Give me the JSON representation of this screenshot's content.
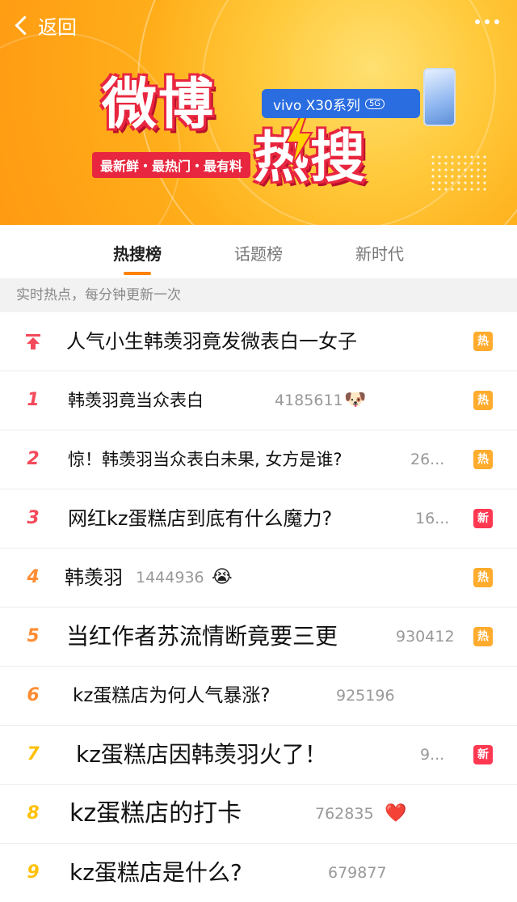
{
  "header": {
    "back_label": "返回",
    "logo_line1": "微博",
    "logo_line2": "热搜",
    "tagline": "最新鲜・最热门・最有料",
    "sponsor": "vivo X30系列",
    "sponsor_badge": "5G"
  },
  "tabs": [
    {
      "label": "热搜榜",
      "active": true
    },
    {
      "label": "话题榜",
      "active": false
    },
    {
      "label": "新时代",
      "active": false
    }
  ],
  "notice": "实时热点，每分钟更新一次",
  "colors": {
    "accent": "#ff8200",
    "hot_badge": "#ffab2d",
    "new_badge": "#ff3852",
    "top_rank": "#f4495a",
    "rank_mid": "#fe8c32",
    "rank_low": "#ffc107"
  },
  "list": [
    {
      "rank": "",
      "pinned": true,
      "title": "人气小生韩羡羽竟发微表白一女子",
      "count": "",
      "emoji": "",
      "badge": "热",
      "badge_type": "hot"
    },
    {
      "rank": "1",
      "title": "韩羡羽竟当众表白",
      "count": "4185611",
      "emoji": "🐶",
      "badge": "热",
      "badge_type": "hot"
    },
    {
      "rank": "2",
      "title": "惊！韩羡羽当众表白未果, 女方是谁?",
      "count": "26...",
      "emoji": "",
      "badge": "热",
      "badge_type": "hot"
    },
    {
      "rank": "3",
      "title": "网红kz蛋糕店到底有什么魔力?",
      "count": "16...",
      "emoji": "",
      "badge": "新",
      "badge_type": "new"
    },
    {
      "rank": "4",
      "title": "韩羡羽",
      "count": "1444936",
      "emoji": "😭",
      "badge": "热",
      "badge_type": "hot"
    },
    {
      "rank": "5",
      "title": "当红作者苏流情断竟要三更",
      "count": "930412",
      "emoji": "",
      "badge": "热",
      "badge_type": "hot"
    },
    {
      "rank": "6",
      "title": "kz蛋糕店为何人气暴涨?",
      "count": "925196",
      "emoji": "",
      "badge": "",
      "badge_type": ""
    },
    {
      "rank": "7",
      "title": "kz蛋糕店因韩羡羽火了！",
      "count": "9...",
      "emoji": "",
      "badge": "新",
      "badge_type": "new"
    },
    {
      "rank": "8",
      "title": "kz蛋糕店的打卡",
      "count": "762835",
      "emoji": "❤️",
      "badge": "",
      "badge_type": ""
    },
    {
      "rank": "9",
      "title": "kz蛋糕店是什么?",
      "count": "679877",
      "emoji": "",
      "badge": "",
      "badge_type": ""
    }
  ]
}
